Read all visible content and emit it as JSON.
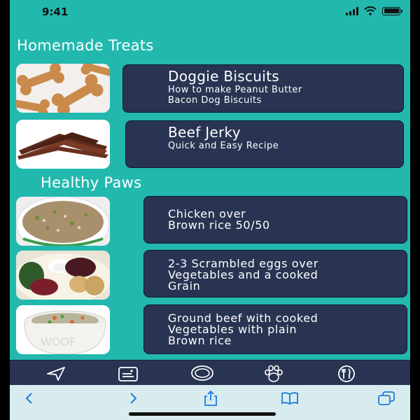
{
  "status": {
    "time": "9:41"
  },
  "sections": {
    "homemade": "Homemade Treats",
    "healthy": "Healthy Paws"
  },
  "cards": [
    {
      "title": "Doggie Biscuits",
      "sub": "How to make Peanut Butter\nBacon Dog Biscuits"
    },
    {
      "title": "Beef Jerky",
      "sub": "Quick and Easy Recipe"
    },
    {
      "body": "Chicken over\nBrown rice 50/50"
    },
    {
      "body": "2-3 Scrambled eggs over\nVegetables and a cooked\nGrain"
    },
    {
      "body": "Ground beef with cooked\nVegetables with plain\nBrown rice"
    }
  ],
  "tabs": [
    "navigation-arrow-icon",
    "id-card-icon",
    "chat-bubble-icon",
    "paw-print-icon",
    "fork-knife-icon"
  ],
  "browser": [
    "back-icon",
    "forward-icon",
    "share-icon",
    "bookmarks-icon",
    "tabs-icon"
  ],
  "colors": {
    "background": "#22b8ad",
    "card": "#283452",
    "text": "#ffffff",
    "browser_bar": "#d8ecef",
    "browser_icon": "#1e7bd6"
  }
}
